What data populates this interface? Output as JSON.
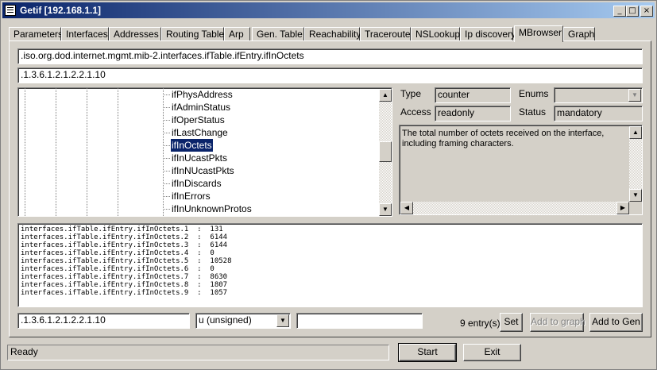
{
  "window": {
    "title": "Getif [192.168.1.1]"
  },
  "tabs": [
    {
      "label": "Parameters"
    },
    {
      "label": "Interfaces"
    },
    {
      "label": "Addresses"
    },
    {
      "label": "Routing Table"
    },
    {
      "label": "Arp"
    },
    {
      "label": "Gen. Table"
    },
    {
      "label": "Reachability"
    },
    {
      "label": "Traceroute"
    },
    {
      "label": "NSLookup"
    },
    {
      "label": "Ip discovery"
    },
    {
      "label": "MBrowser"
    },
    {
      "label": "Graph"
    }
  ],
  "active_tab": "MBrowser",
  "oid_name": ".iso.org.dod.internet.mgmt.mib-2.interfaces.ifTable.ifEntry.ifInOctets",
  "oid_number": ".1.3.6.1.2.1.2.2.1.10",
  "tree": {
    "items": [
      {
        "label": "ifPhysAddress"
      },
      {
        "label": "ifAdminStatus"
      },
      {
        "label": "ifOperStatus"
      },
      {
        "label": "ifLastChange"
      },
      {
        "label": "ifInOctets"
      },
      {
        "label": "ifInUcastPkts"
      },
      {
        "label": "ifInNUcastPkts"
      },
      {
        "label": "ifInDiscards"
      },
      {
        "label": "ifInErrors"
      },
      {
        "label": "ifInUnknownProtos"
      }
    ],
    "selected": "ifInOctets"
  },
  "properties": {
    "type_label": "Type",
    "type_value": "counter",
    "enums_label": "Enums",
    "enums_value": "",
    "access_label": "Access",
    "access_value": "readonly",
    "status_label": "Status",
    "status_value": "mandatory",
    "description": "The total number of octets received on the interface, including framing characters."
  },
  "output_lines": [
    "interfaces.ifTable.ifEntry.ifInOctets.1  :  131",
    "interfaces.ifTable.ifEntry.ifInOctets.2  :  6144",
    "interfaces.ifTable.ifEntry.ifInOctets.3  :  6144",
    "interfaces.ifTable.ifEntry.ifInOctets.4  :  0",
    "interfaces.ifTable.ifEntry.ifInOctets.5  :  10528",
    "interfaces.ifTable.ifEntry.ifInOctets.6  :  0",
    "interfaces.ifTable.ifEntry.ifInOctets.7  :  8630",
    "interfaces.ifTable.ifEntry.ifInOctets.8  :  1807",
    "interfaces.ifTable.ifEntry.ifInOctets.9  :  1057"
  ],
  "set_row": {
    "oid_value": ".1.3.6.1.2.1.2.2.1.10",
    "type_selected": "u (unsigned)",
    "value": "",
    "entry_count": "9 entry(s)",
    "set_label": "Set",
    "add_graph_label": "Add to graph",
    "add_gen_label": "Add to Gen"
  },
  "status": {
    "text": "Ready",
    "start_label": "Start",
    "exit_label": "Exit"
  },
  "colors": {
    "face": "#d4d0c8",
    "selection": "#0a246a",
    "title_start": "#0a246a",
    "title_end": "#a6caf0"
  }
}
